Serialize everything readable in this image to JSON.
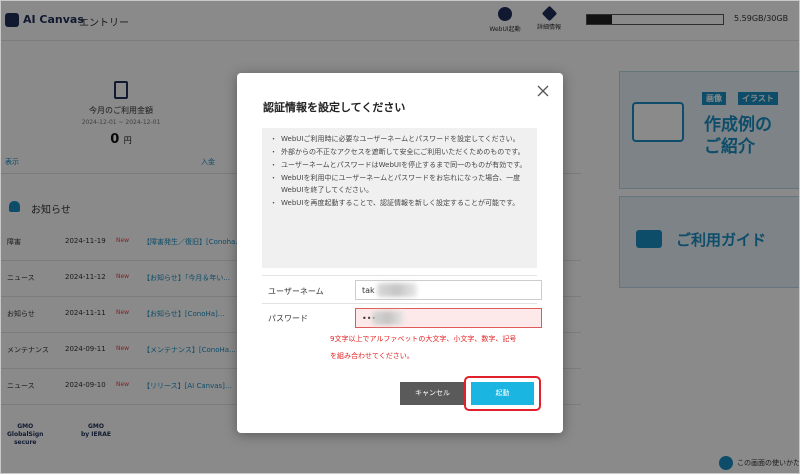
{
  "header": {
    "logo": "AI Canvas",
    "page": "エントリー",
    "webui_launch_label": "WebUI起動",
    "detail_label": "詳細情報",
    "storage_text": "5.59GB/30GB",
    "storage_fraction": 0.186
  },
  "usage": {
    "title": "今月のご利用金額",
    "range": "2024-12-01 ~ 2024-12-01",
    "amount": "0",
    "unit": "円",
    "link_left": "表示",
    "link_mid": "入金"
  },
  "news": {
    "heading": "お知らせ",
    "new_label": "New",
    "items": [
      {
        "category": "障害",
        "date": "2024-11-19",
        "title": "【障害発生／復旧】[Conoha..."
      },
      {
        "category": "ニュース",
        "date": "2024-11-12",
        "title": "【お知らせ】「今月＆年い..."
      },
      {
        "category": "お知らせ",
        "date": "2024-11-11",
        "title": "【お知らせ】[ConoHa]..."
      },
      {
        "category": "メンテナンス",
        "date": "2024-09-11",
        "title": "【メンテナンス】[ConoHa..."
      },
      {
        "category": "ニュース",
        "date": "2024-09-10",
        "title": "【リリース】[AI Canvas]..."
      }
    ]
  },
  "banners": {
    "tag_image": "画像",
    "tag_illust": "イラスト",
    "line1": "作成例の",
    "line2": "ご紹介",
    "guide": "ご利用ガイド"
  },
  "footer": {
    "gmo1": "GMO\nGlobalSign\nsecure",
    "gmo2": "GMO\nby IERAE",
    "help": "この画面の使いかた"
  },
  "modal": {
    "title": "認証情報を設定してください",
    "notes": [
      "WebUIご利用時に必要なユーザーネームとパスワードを設定してください。",
      "外部からの不正なアクセスを遮断して安全にご利用いただくためのものです。",
      "ユーザーネームとパスワードはWebUIを停止するまで同一のものが有効です。",
      "WebUIを利用中にユーザーネームとパスワードをお忘れになった場合、一度WebUIを終了してください。",
      "WebUIを再度起動することで、認証情報を新しく設定することが可能です。"
    ],
    "username_label": "ユーザーネーム",
    "username_value": "tak",
    "password_label": "パスワード",
    "password_value": "•••",
    "error": "9文字以上でアルファベットの大文字、小文字、数字、記号を組み合わせてください。",
    "cancel": "キャンセル",
    "launch": "起動"
  }
}
